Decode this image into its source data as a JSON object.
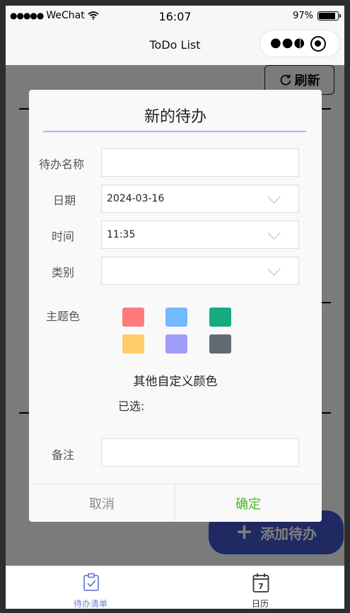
{
  "status_bar": {
    "carrier": "WeChat",
    "signal_dots": "●●●●●",
    "time": "16:07",
    "battery": "97%"
  },
  "nav": {
    "title": "ToDo List"
  },
  "page": {
    "refresh_label": "刷新",
    "add_label": "添加待办",
    "add_color": "#3f53c4"
  },
  "dialog": {
    "title": "新的待办",
    "fields": {
      "name_label": "待办名称",
      "name_value": "",
      "date_label": "日期",
      "date_value": "2024-03-16",
      "time_label": "时间",
      "time_value": "11:35",
      "category_label": "类别",
      "category_value": ""
    },
    "theme_label": "主题色",
    "swatches": [
      "#ff7b7b",
      "#73b9ff",
      "#13ab7f",
      "#ffcd6b",
      "#a09dfb",
      "#636b72"
    ],
    "custom_color_label": "其他自定义颜色",
    "selected_label": "已选:",
    "note_label": "备注",
    "note_value": "",
    "cancel_label": "取消",
    "confirm_label": "确定",
    "confirm_color": "#3fbd1d"
  },
  "tabbar": {
    "tabs": [
      {
        "label": "待办清单",
        "icon": "clipboard-check-icon",
        "active": true
      },
      {
        "label": "日历",
        "icon": "calendar-7-icon",
        "active": false
      }
    ],
    "active_color": "#6b7fd8",
    "calendar_day": "7"
  }
}
